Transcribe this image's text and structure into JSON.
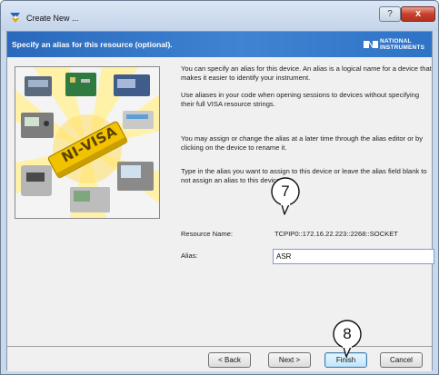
{
  "window": {
    "title": "Create New ...",
    "help_glyph": "?",
    "close_glyph": "x"
  },
  "header": {
    "title": "Specify an alias for this resource (optional).",
    "logo_line1": "NATIONAL",
    "logo_line2": "INSTRUMENTS"
  },
  "illustration": {
    "label": "NI-VISA"
  },
  "instructions": [
    "You can specify an alias for this device. An alias is a logical name for a device that makes it easier to identify your instrument.",
    "Use aliases in your code when opening sessions to devices without specifying their full VISA resource strings.",
    "You may assign or change the alias at a later time through the alias editor or by clicking on the device to rename it.",
    "Type in the alias you want to assign to this device or leave the alias field blank to not assign an alias to this device."
  ],
  "form": {
    "resource_label": "Resource Name:",
    "resource_value": "TCPIP0::172.16.22.223::2268::SOCKET",
    "alias_label": "Alias:",
    "alias_value": "ASR"
  },
  "buttons": {
    "back": "< Back",
    "next": "Next >",
    "finish": "Finish",
    "cancel": "Cancel"
  },
  "callouts": {
    "alias_step": "7",
    "finish_step": "8"
  },
  "colors": {
    "header_band": "#2f73c6",
    "title_bar": "#c9d9ec",
    "close_button": "#c7402c"
  }
}
